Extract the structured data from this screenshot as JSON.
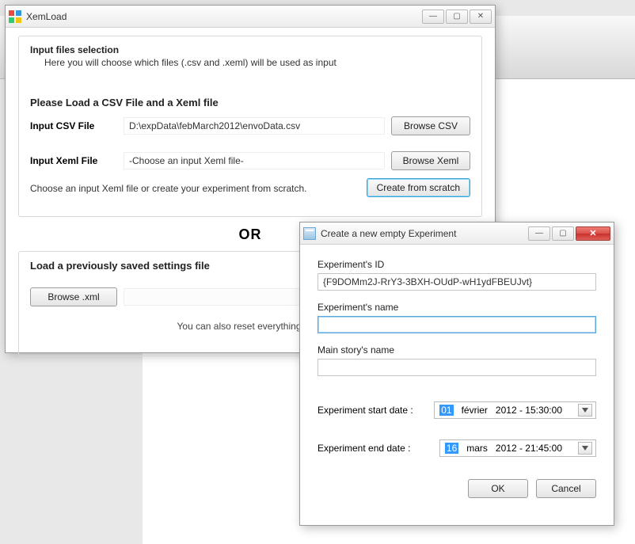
{
  "main_window": {
    "title": "XemLoad",
    "group": {
      "title": "Input files selection",
      "subtitle": "Here you will choose which files (.csv and .xeml) will be used as input"
    },
    "heading": "Please Load a CSV File and a Xeml file",
    "csv": {
      "label": "Input CSV File",
      "value": "D:\\expData\\febMarch2012\\envoData.csv",
      "button": "Browse CSV"
    },
    "xeml": {
      "label": "Input Xeml File",
      "value": "-Choose an input Xeml file-",
      "button": "Browse Xeml",
      "hint": "Choose an input Xeml file or create your experiment from scratch.",
      "create_button": "Create from scratch"
    },
    "or_text": "OR",
    "load_settings_heading": "Load a previously saved settings file",
    "browse_xml_button": "Browse .xml",
    "footer_hint": "You can also reset everything by cl"
  },
  "dialog": {
    "title": "Create a new empty Experiment",
    "exp_id_label": "Experiment's ID",
    "exp_id_value": "{F9DOMm2J-RrY3-3BXH-OUdP-wH1ydFBEUJvt}",
    "exp_name_label": "Experiment's name",
    "exp_name_value": "",
    "story_label": "Main story's name",
    "story_value": "",
    "start_label": "Experiment start date :",
    "start_day": "01",
    "start_month": "février",
    "start_rest": "2012 - 15:30:00",
    "end_label": "Experiment end date :",
    "end_day": "16",
    "end_month": "mars",
    "end_rest": "2012 - 21:45:00",
    "ok": "OK",
    "cancel": "Cancel"
  }
}
